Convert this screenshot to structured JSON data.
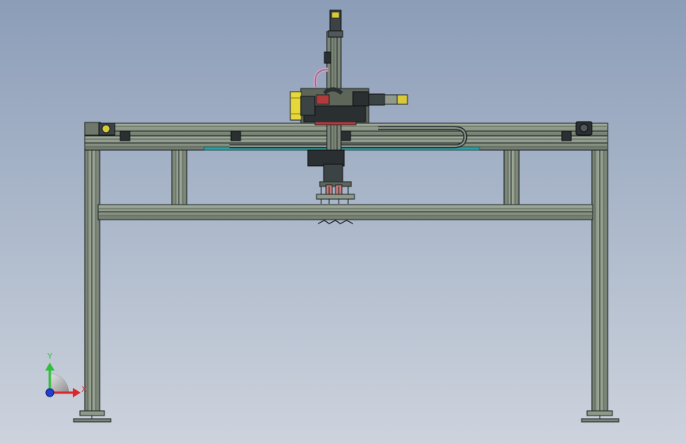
{
  "triad": {
    "y_label": "Y",
    "x_label": "X",
    "colors": {
      "y_axis": "#2fbf3a",
      "x_axis": "#d8282a",
      "z_origin": "#1d3fd8"
    }
  },
  "palette": {
    "frame_fill": "#8f9a8a",
    "frame_edge": "#1d2426",
    "slot_line": "#566057",
    "motor_yellow": "#e6d83a",
    "accent_red": "#b23a3a",
    "cable_pink": "#c9a0c0",
    "rail_teal": "#2e9ea0"
  }
}
